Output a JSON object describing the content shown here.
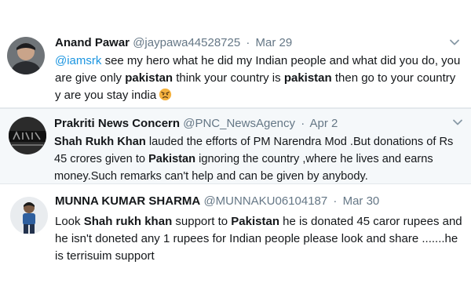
{
  "tweets": [
    {
      "name": "Anand Pawar",
      "handle": "@jaypawa44528725",
      "separator": "·",
      "date": "Mar 29",
      "body": {
        "mention": "@iamsrk",
        "text1": " see my hero what he did my Indian people and what did you do, you are give only ",
        "bold1": "pakistan",
        "text2": " think your country is ",
        "bold2": "pakistan",
        "text3": " then go to your country y are you stay india"
      },
      "emoji": "angry-face-icon"
    },
    {
      "name": "Prakriti News Concern",
      "handle": "@PNC_NewsAgency",
      "separator": "·",
      "date": "Apr 2",
      "body": {
        "bold1": "Shah Rukh Khan",
        "text1": " lauded the efforts of PM Narendra Mod .But donations of Rs 45 crores given to ",
        "bold2": "Pakistan",
        "text2": " ignoring the country ,where he lives and earns money.Such remarks can't help and can be given by anybody."
      }
    },
    {
      "name": "MUNNA KUMAR SHARMA",
      "handle": "@MUNNAKU06104187",
      "separator": "·",
      "date": "Mar 30",
      "body": {
        "text1": "Look ",
        "bold1": "Shah rukh khan",
        "text2": " support to ",
        "bold2": "Pakistan",
        "text3": " he is donated 45 caror rupees and he isn't doneted any 1 rupees for Indian people please look and share .......he is terrisuim support"
      }
    }
  ],
  "colors": {
    "link": "#1b95e0",
    "muted": "#657786",
    "highlight_bg": "#f5f8fa"
  },
  "icons": {
    "caret": "chevron-down-icon"
  }
}
